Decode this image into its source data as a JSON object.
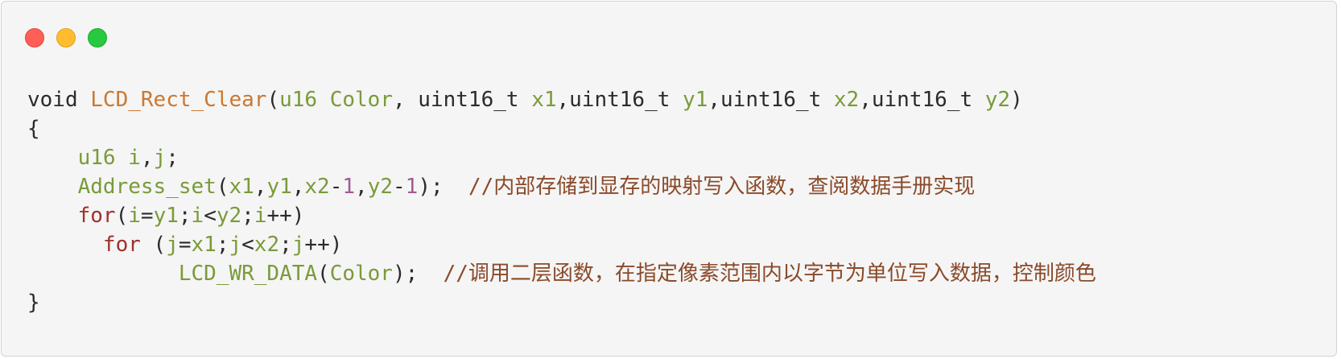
{
  "window": {
    "controls": [
      "close",
      "minimize",
      "maximize"
    ],
    "colors": {
      "close": "#ff5f56",
      "minimize": "#ffbd2e",
      "maximize": "#27c93f"
    }
  },
  "code": {
    "l1": {
      "kw_void": "void",
      "sp1": " ",
      "fn_name": "LCD_Rect_Clear",
      "p_open": "(",
      "t1": "u16",
      "sp2": " ",
      "a1": "Color",
      "s1": ", uint16_t ",
      "a2": "x1",
      "s2": ",uint16_t ",
      "a3": "y1",
      "s3": ",uint16_t ",
      "a4": "x2",
      "s4": ",uint16_t ",
      "a5": "y2",
      "p_close": ")"
    },
    "l2": {
      "brace": "{"
    },
    "l3": {
      "indent": "    ",
      "decl": "u16 i",
      "comma": ",",
      "j": "j",
      "semi": ";"
    },
    "l4": {
      "indent": "    ",
      "fn": "Address_set",
      "p_open": "(",
      "a1": "x1",
      "c1": ",",
      "a2": "y1",
      "c2": ",",
      "a3": "x2",
      "m1": "-",
      "n1": "1",
      "c3": ",",
      "a4": "y2",
      "m2": "-",
      "n2": "1",
      "end": ");  ",
      "comment": "//内部存储到显存的映射写入函数，查阅数据手册实现"
    },
    "l5": {
      "indent": "    ",
      "kw_for": "for",
      "p_open": "(",
      "v1": "i",
      "eq": "=",
      "v2": "y1",
      "sc1": ";",
      "v3": "i",
      "lt": "<",
      "v4": "y2",
      "sc2": ";",
      "v5": "i",
      "inc": "++)"
    },
    "l6": {
      "indent": "      ",
      "kw_for": "for",
      "p_open": " (",
      "v1": "j",
      "eq": "=",
      "v2": "x1",
      "sc1": ";",
      "v3": "j",
      "lt": "<",
      "v4": "x2",
      "sc2": ";",
      "v5": "j",
      "inc": "++)"
    },
    "l7": {
      "indent": "            ",
      "fn": "LCD_WR_DATA",
      "p_open": "(",
      "a1": "Color",
      "end": ");  ",
      "comment": "//调用二层函数，在指定像素范围内以字节为单位写入数据，控制颜色"
    },
    "l8": {
      "brace": "}"
    }
  }
}
